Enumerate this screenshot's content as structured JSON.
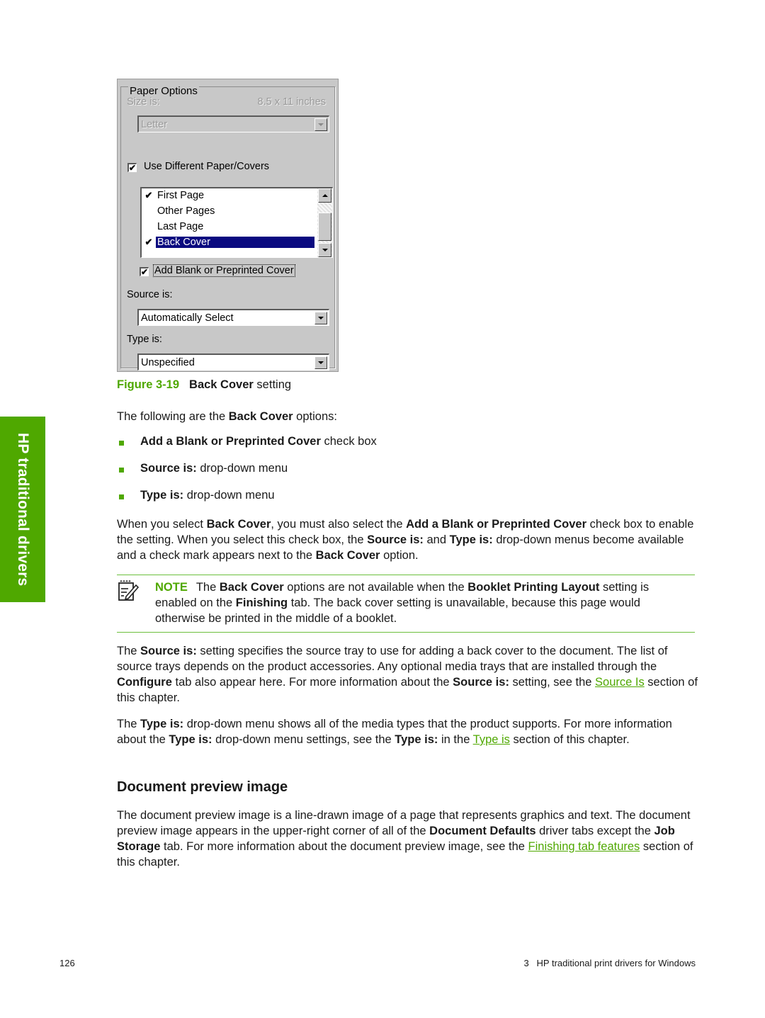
{
  "side_tab": {
    "label": "HP traditional drivers",
    "color": "#4fa800"
  },
  "dialog": {
    "group_title": "Paper Options",
    "size_label": "Size is:",
    "size_value": "8.5 x 11 inches",
    "size_combo_value": "Letter",
    "use_different_label": "Use Different Paper/Covers",
    "use_different_checked": true,
    "list_items": [
      {
        "label": "First Page",
        "checked": true,
        "selected": false
      },
      {
        "label": "Other Pages",
        "checked": false,
        "selected": false
      },
      {
        "label": "Last Page",
        "checked": false,
        "selected": false
      },
      {
        "label": "Back Cover",
        "checked": true,
        "selected": true
      }
    ],
    "add_blank_label": "Add Blank or Preprinted Cover",
    "add_blank_checked": true,
    "source_label": "Source is:",
    "source_value": "Automatically Select",
    "type_label": "Type is:",
    "type_value": "Unspecified",
    "check_glyph": "✔"
  },
  "caption": {
    "number": "Figure 3-19",
    "bold": "Back Cover",
    "rest": " setting"
  },
  "intro": {
    "pre": "The following are the ",
    "bold": "Back Cover",
    "post": " options:"
  },
  "bullets": [
    {
      "bold": "Add a Blank or Preprinted Cover",
      "rest": " check box"
    },
    {
      "bold": "Source is:",
      "rest": " drop-down menu"
    },
    {
      "bold": "Type is:",
      "rest": " drop-down menu"
    }
  ],
  "para1": {
    "t1": "When you select ",
    "b1": "Back Cover",
    "t2": ", you must also select the ",
    "b2": "Add a Blank or Preprinted Cover",
    "t3": " check box to enable the setting. When you select this check box, the ",
    "b3": "Source is:",
    "t4": " and ",
    "b4": "Type is:",
    "t5": " drop-down menus become available and a check mark appears next to the ",
    "b5": "Back Cover",
    "t6": " option."
  },
  "note": {
    "label": "NOTE",
    "t1": "The ",
    "b1": "Back Cover",
    "t2": " options are not available when the ",
    "b2": "Booklet Printing Layout",
    "t3": " setting is enabled on the ",
    "b3": "Finishing",
    "t4": " tab. The back cover setting is unavailable, because this page would otherwise be printed in the middle of a booklet."
  },
  "para2": {
    "t1": "The ",
    "b1": "Source is:",
    "t2": " setting specifies the source tray to use for adding a back cover to the document. The list of source trays depends on the product accessories. Any optional media trays that are installed through the ",
    "b2": "Configure",
    "t3": " tab also appear here. For more information about the ",
    "b3": "Source is:",
    "t4": " setting, see the ",
    "link": "Source Is",
    "t5": " section of this chapter."
  },
  "para3": {
    "t1": "The ",
    "b1": "Type is:",
    "t2": " drop-down menu shows all of the media types that the product supports. For more information about the ",
    "b2": "Type is:",
    "t3": " drop-down menu settings, see the ",
    "b3": "Type is:",
    "t4": " in the ",
    "link": "Type is",
    "t5": " section of this chapter."
  },
  "heading": "Document preview image",
  "para4": {
    "t1": "The document preview image is a line-drawn image of a page that represents graphics and text. The document preview image appears in the upper-right corner of all of the ",
    "b1": "Document Defaults",
    "t2": " driver tabs except the ",
    "b2": "Job Storage",
    "t3": " tab. For more information about the document preview image, see the ",
    "link": "Finishing tab features",
    "t4": " section of this chapter."
  },
  "footer": {
    "page_number": "126",
    "chapter": "3   HP traditional print drivers for Windows"
  }
}
